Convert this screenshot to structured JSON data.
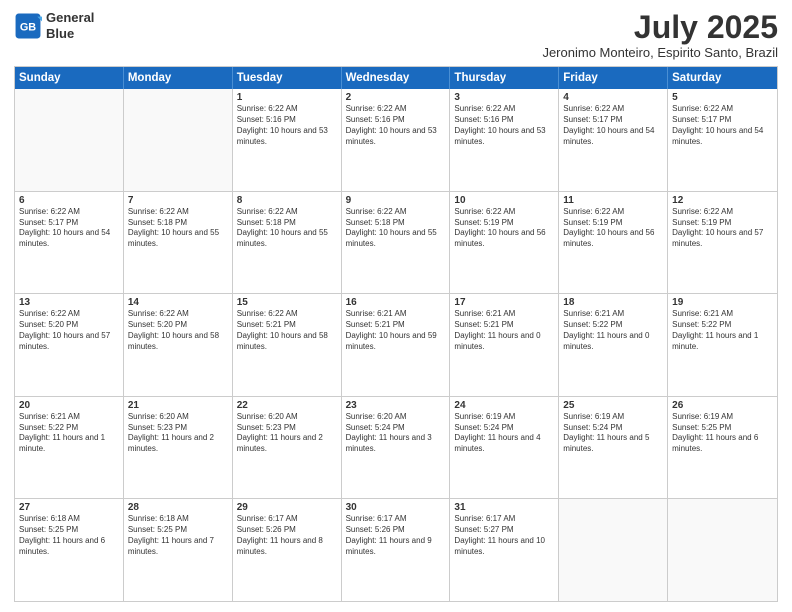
{
  "logo": {
    "line1": "General",
    "line2": "Blue"
  },
  "title": "July 2025",
  "location": "Jeronimo Monteiro, Espirito Santo, Brazil",
  "headers": [
    "Sunday",
    "Monday",
    "Tuesday",
    "Wednesday",
    "Thursday",
    "Friday",
    "Saturday"
  ],
  "weeks": [
    [
      {
        "day": "",
        "text": ""
      },
      {
        "day": "",
        "text": ""
      },
      {
        "day": "1",
        "text": "Sunrise: 6:22 AM\nSunset: 5:16 PM\nDaylight: 10 hours and 53 minutes."
      },
      {
        "day": "2",
        "text": "Sunrise: 6:22 AM\nSunset: 5:16 PM\nDaylight: 10 hours and 53 minutes."
      },
      {
        "day": "3",
        "text": "Sunrise: 6:22 AM\nSunset: 5:16 PM\nDaylight: 10 hours and 53 minutes."
      },
      {
        "day": "4",
        "text": "Sunrise: 6:22 AM\nSunset: 5:17 PM\nDaylight: 10 hours and 54 minutes."
      },
      {
        "day": "5",
        "text": "Sunrise: 6:22 AM\nSunset: 5:17 PM\nDaylight: 10 hours and 54 minutes."
      }
    ],
    [
      {
        "day": "6",
        "text": "Sunrise: 6:22 AM\nSunset: 5:17 PM\nDaylight: 10 hours and 54 minutes."
      },
      {
        "day": "7",
        "text": "Sunrise: 6:22 AM\nSunset: 5:18 PM\nDaylight: 10 hours and 55 minutes."
      },
      {
        "day": "8",
        "text": "Sunrise: 6:22 AM\nSunset: 5:18 PM\nDaylight: 10 hours and 55 minutes."
      },
      {
        "day": "9",
        "text": "Sunrise: 6:22 AM\nSunset: 5:18 PM\nDaylight: 10 hours and 55 minutes."
      },
      {
        "day": "10",
        "text": "Sunrise: 6:22 AM\nSunset: 5:19 PM\nDaylight: 10 hours and 56 minutes."
      },
      {
        "day": "11",
        "text": "Sunrise: 6:22 AM\nSunset: 5:19 PM\nDaylight: 10 hours and 56 minutes."
      },
      {
        "day": "12",
        "text": "Sunrise: 6:22 AM\nSunset: 5:19 PM\nDaylight: 10 hours and 57 minutes."
      }
    ],
    [
      {
        "day": "13",
        "text": "Sunrise: 6:22 AM\nSunset: 5:20 PM\nDaylight: 10 hours and 57 minutes."
      },
      {
        "day": "14",
        "text": "Sunrise: 6:22 AM\nSunset: 5:20 PM\nDaylight: 10 hours and 58 minutes."
      },
      {
        "day": "15",
        "text": "Sunrise: 6:22 AM\nSunset: 5:21 PM\nDaylight: 10 hours and 58 minutes."
      },
      {
        "day": "16",
        "text": "Sunrise: 6:21 AM\nSunset: 5:21 PM\nDaylight: 10 hours and 59 minutes."
      },
      {
        "day": "17",
        "text": "Sunrise: 6:21 AM\nSunset: 5:21 PM\nDaylight: 11 hours and 0 minutes."
      },
      {
        "day": "18",
        "text": "Sunrise: 6:21 AM\nSunset: 5:22 PM\nDaylight: 11 hours and 0 minutes."
      },
      {
        "day": "19",
        "text": "Sunrise: 6:21 AM\nSunset: 5:22 PM\nDaylight: 11 hours and 1 minute."
      }
    ],
    [
      {
        "day": "20",
        "text": "Sunrise: 6:21 AM\nSunset: 5:22 PM\nDaylight: 11 hours and 1 minute."
      },
      {
        "day": "21",
        "text": "Sunrise: 6:20 AM\nSunset: 5:23 PM\nDaylight: 11 hours and 2 minutes."
      },
      {
        "day": "22",
        "text": "Sunrise: 6:20 AM\nSunset: 5:23 PM\nDaylight: 11 hours and 2 minutes."
      },
      {
        "day": "23",
        "text": "Sunrise: 6:20 AM\nSunset: 5:24 PM\nDaylight: 11 hours and 3 minutes."
      },
      {
        "day": "24",
        "text": "Sunrise: 6:19 AM\nSunset: 5:24 PM\nDaylight: 11 hours and 4 minutes."
      },
      {
        "day": "25",
        "text": "Sunrise: 6:19 AM\nSunset: 5:24 PM\nDaylight: 11 hours and 5 minutes."
      },
      {
        "day": "26",
        "text": "Sunrise: 6:19 AM\nSunset: 5:25 PM\nDaylight: 11 hours and 6 minutes."
      }
    ],
    [
      {
        "day": "27",
        "text": "Sunrise: 6:18 AM\nSunset: 5:25 PM\nDaylight: 11 hours and 6 minutes."
      },
      {
        "day": "28",
        "text": "Sunrise: 6:18 AM\nSunset: 5:25 PM\nDaylight: 11 hours and 7 minutes."
      },
      {
        "day": "29",
        "text": "Sunrise: 6:17 AM\nSunset: 5:26 PM\nDaylight: 11 hours and 8 minutes."
      },
      {
        "day": "30",
        "text": "Sunrise: 6:17 AM\nSunset: 5:26 PM\nDaylight: 11 hours and 9 minutes."
      },
      {
        "day": "31",
        "text": "Sunrise: 6:17 AM\nSunset: 5:27 PM\nDaylight: 11 hours and 10 minutes."
      },
      {
        "day": "",
        "text": ""
      },
      {
        "day": "",
        "text": ""
      }
    ]
  ]
}
